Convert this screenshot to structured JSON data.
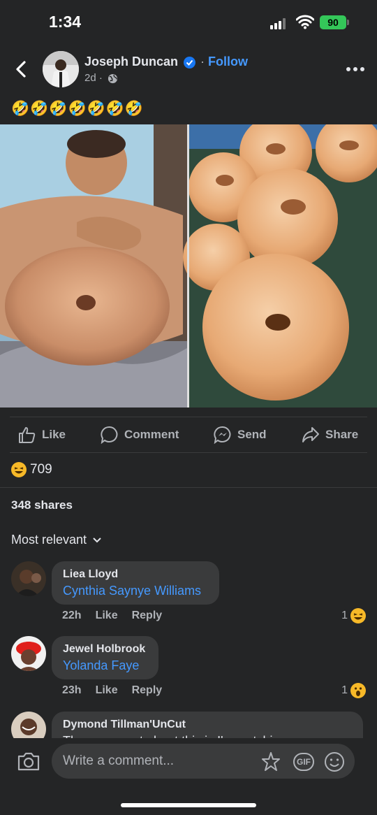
{
  "status_bar": {
    "time": "1:34",
    "battery": "90"
  },
  "post": {
    "author": "Joseph Duncan",
    "separator": "·",
    "follow_label": "Follow",
    "time_ago": "2d ·",
    "caption": "🤣🤣🤣🤣🤣🤣🤣"
  },
  "actions": {
    "like": "Like",
    "comment": "Comment",
    "send": "Send",
    "share": "Share"
  },
  "reactions": {
    "count": "709"
  },
  "shares": {
    "label": "348 shares"
  },
  "sort": {
    "label": "Most relevant"
  },
  "comments": [
    {
      "name": "Liea Lloyd",
      "text": "Cynthia Saynye Williams",
      "time": "22h",
      "like": "Like",
      "reply": "Reply",
      "reaction_count": "1"
    },
    {
      "name": "Jewel Holbrook",
      "text": "Yolanda Faye",
      "time": "23h",
      "like": "Like",
      "reply": "Reply",
      "reaction_count": "1"
    },
    {
      "name": "Dymond Tillman'UnCut",
      "text": "The crazy part about this is I'm watching a"
    }
  ],
  "composer": {
    "placeholder": "Write a comment...",
    "gif": "GIF"
  },
  "colors": {
    "background": "#242526",
    "link": "#4599ff",
    "bubble": "#3a3b3c",
    "battery": "#34c759"
  }
}
